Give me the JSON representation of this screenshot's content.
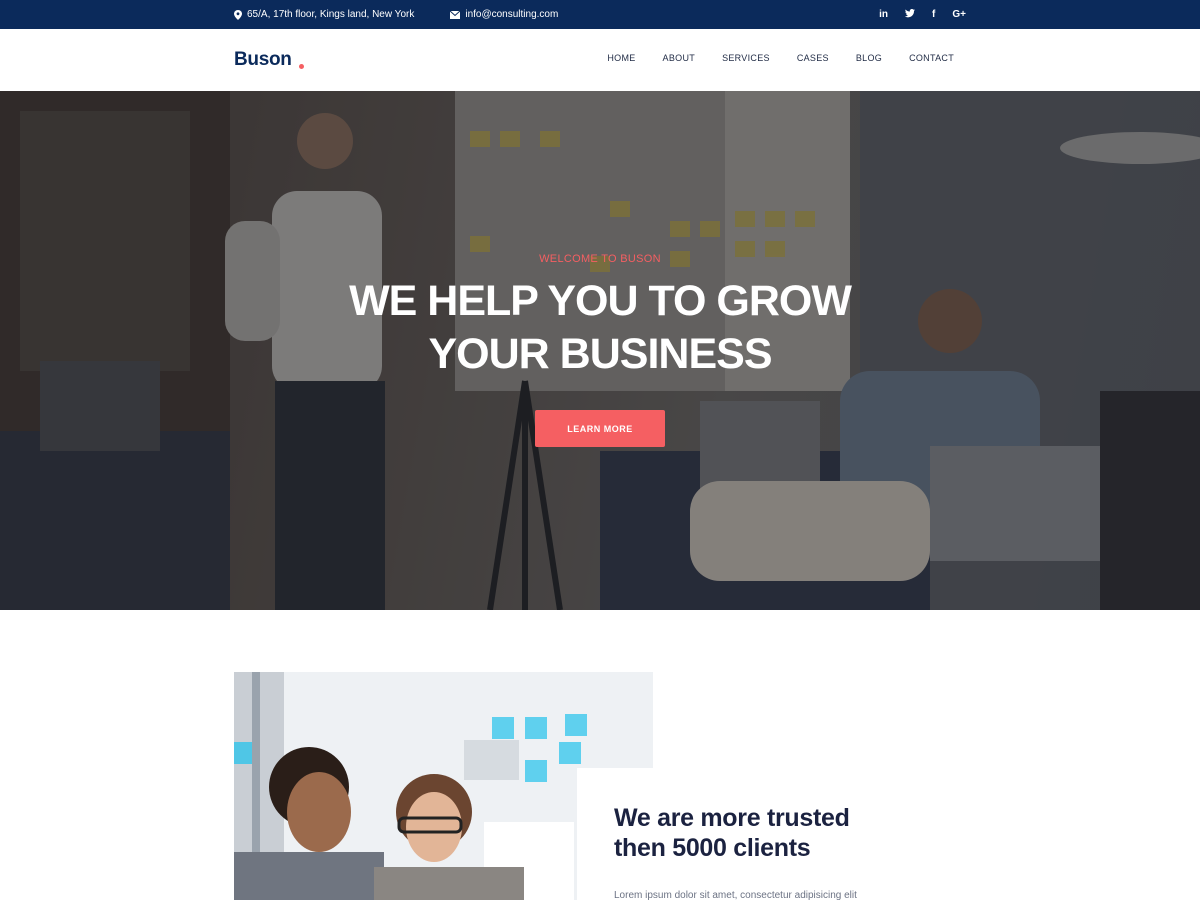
{
  "topbar": {
    "address": "65/A, 17th floor, Kings land, New York",
    "email": "info@consulting.com",
    "social": [
      {
        "icon": "linkedin-icon",
        "label": "in"
      },
      {
        "icon": "twitter-icon",
        "label": "♦"
      },
      {
        "icon": "facebook-icon",
        "label": "f"
      },
      {
        "icon": "google-plus-icon",
        "label": "G+"
      }
    ]
  },
  "header": {
    "logo": "Buson",
    "nav": [
      "HOME",
      "ABOUT",
      "SERVICES",
      "CASES",
      "BLOG",
      "CONTACT"
    ]
  },
  "hero": {
    "kicker": "WELCOME TO BUSON",
    "title_line1": "WE HELP YOU TO GROW",
    "title_line2": "YOUR BUSINESS",
    "button": "LEARN MORE"
  },
  "about": {
    "heading_line1": "We are more trusted",
    "heading_line2": "then 5000 clients",
    "text": "Lorem ipsum dolor sit amet, consectetur adipisicing elit"
  },
  "colors": {
    "navy": "#0b2a5b",
    "accent": "#f55f62",
    "heading": "#1b2240"
  }
}
